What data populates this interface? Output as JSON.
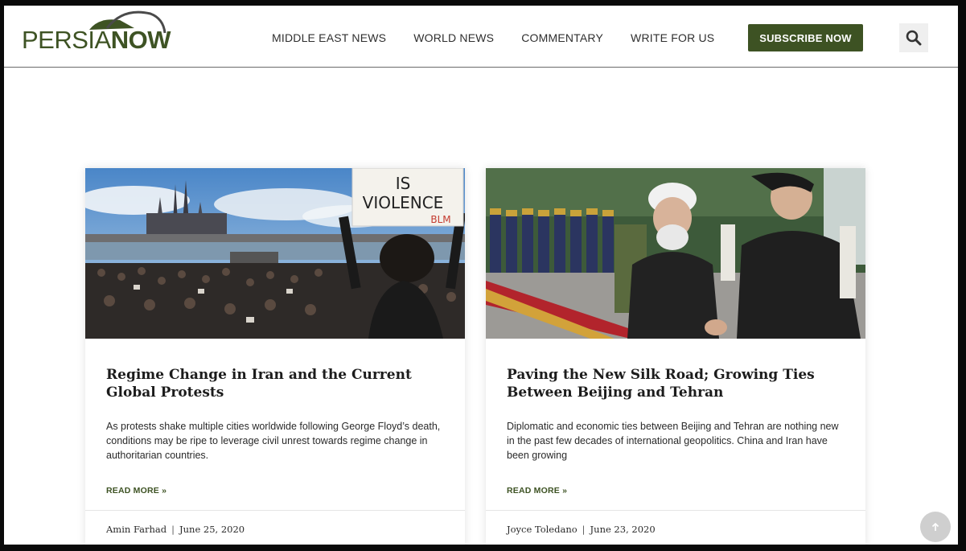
{
  "brand": {
    "logo_part1": "PERSIA",
    "logo_part2": "NOW",
    "color": "#3e5324"
  },
  "nav": {
    "items": [
      {
        "label": "MIDDLE EAST NEWS"
      },
      {
        "label": "WORLD NEWS"
      },
      {
        "label": "COMMENTARY"
      },
      {
        "label": "WRITE FOR US"
      }
    ],
    "subscribe_label": "SUBSCRIBE NOW",
    "search_icon": "search-icon"
  },
  "articles": [
    {
      "title": "Regime Change in Iran and the Current Global Protests",
      "excerpt": "As protests shake multiple cities worldwide following George Floyd’s death, conditions may be ripe to leverage civil unrest towards regime change in authoritarian countries.",
      "read_more": "READ MORE »",
      "author": "Amin Farhad",
      "separator": "|",
      "date": "June 25, 2020",
      "image": {
        "sign_line1": "IS",
        "sign_line2": "VIOLENCE",
        "sign_line3": "BLM"
      }
    },
    {
      "title": "Paving the New Silk Road; Growing Ties Between Beijing and Tehran",
      "excerpt": "Diplomatic and economic ties between Beijing and Tehran are nothing new in the past few decades of international geopolitics. China and Iran have been growing",
      "read_more": "READ MORE »",
      "author": "Joyce Toledano",
      "separator": "|",
      "date": "June 23, 2020"
    }
  ],
  "colors": {
    "accent": "#3d5223",
    "text": "#2a2a2a"
  },
  "scroll_top_icon": "arrow-up-icon"
}
